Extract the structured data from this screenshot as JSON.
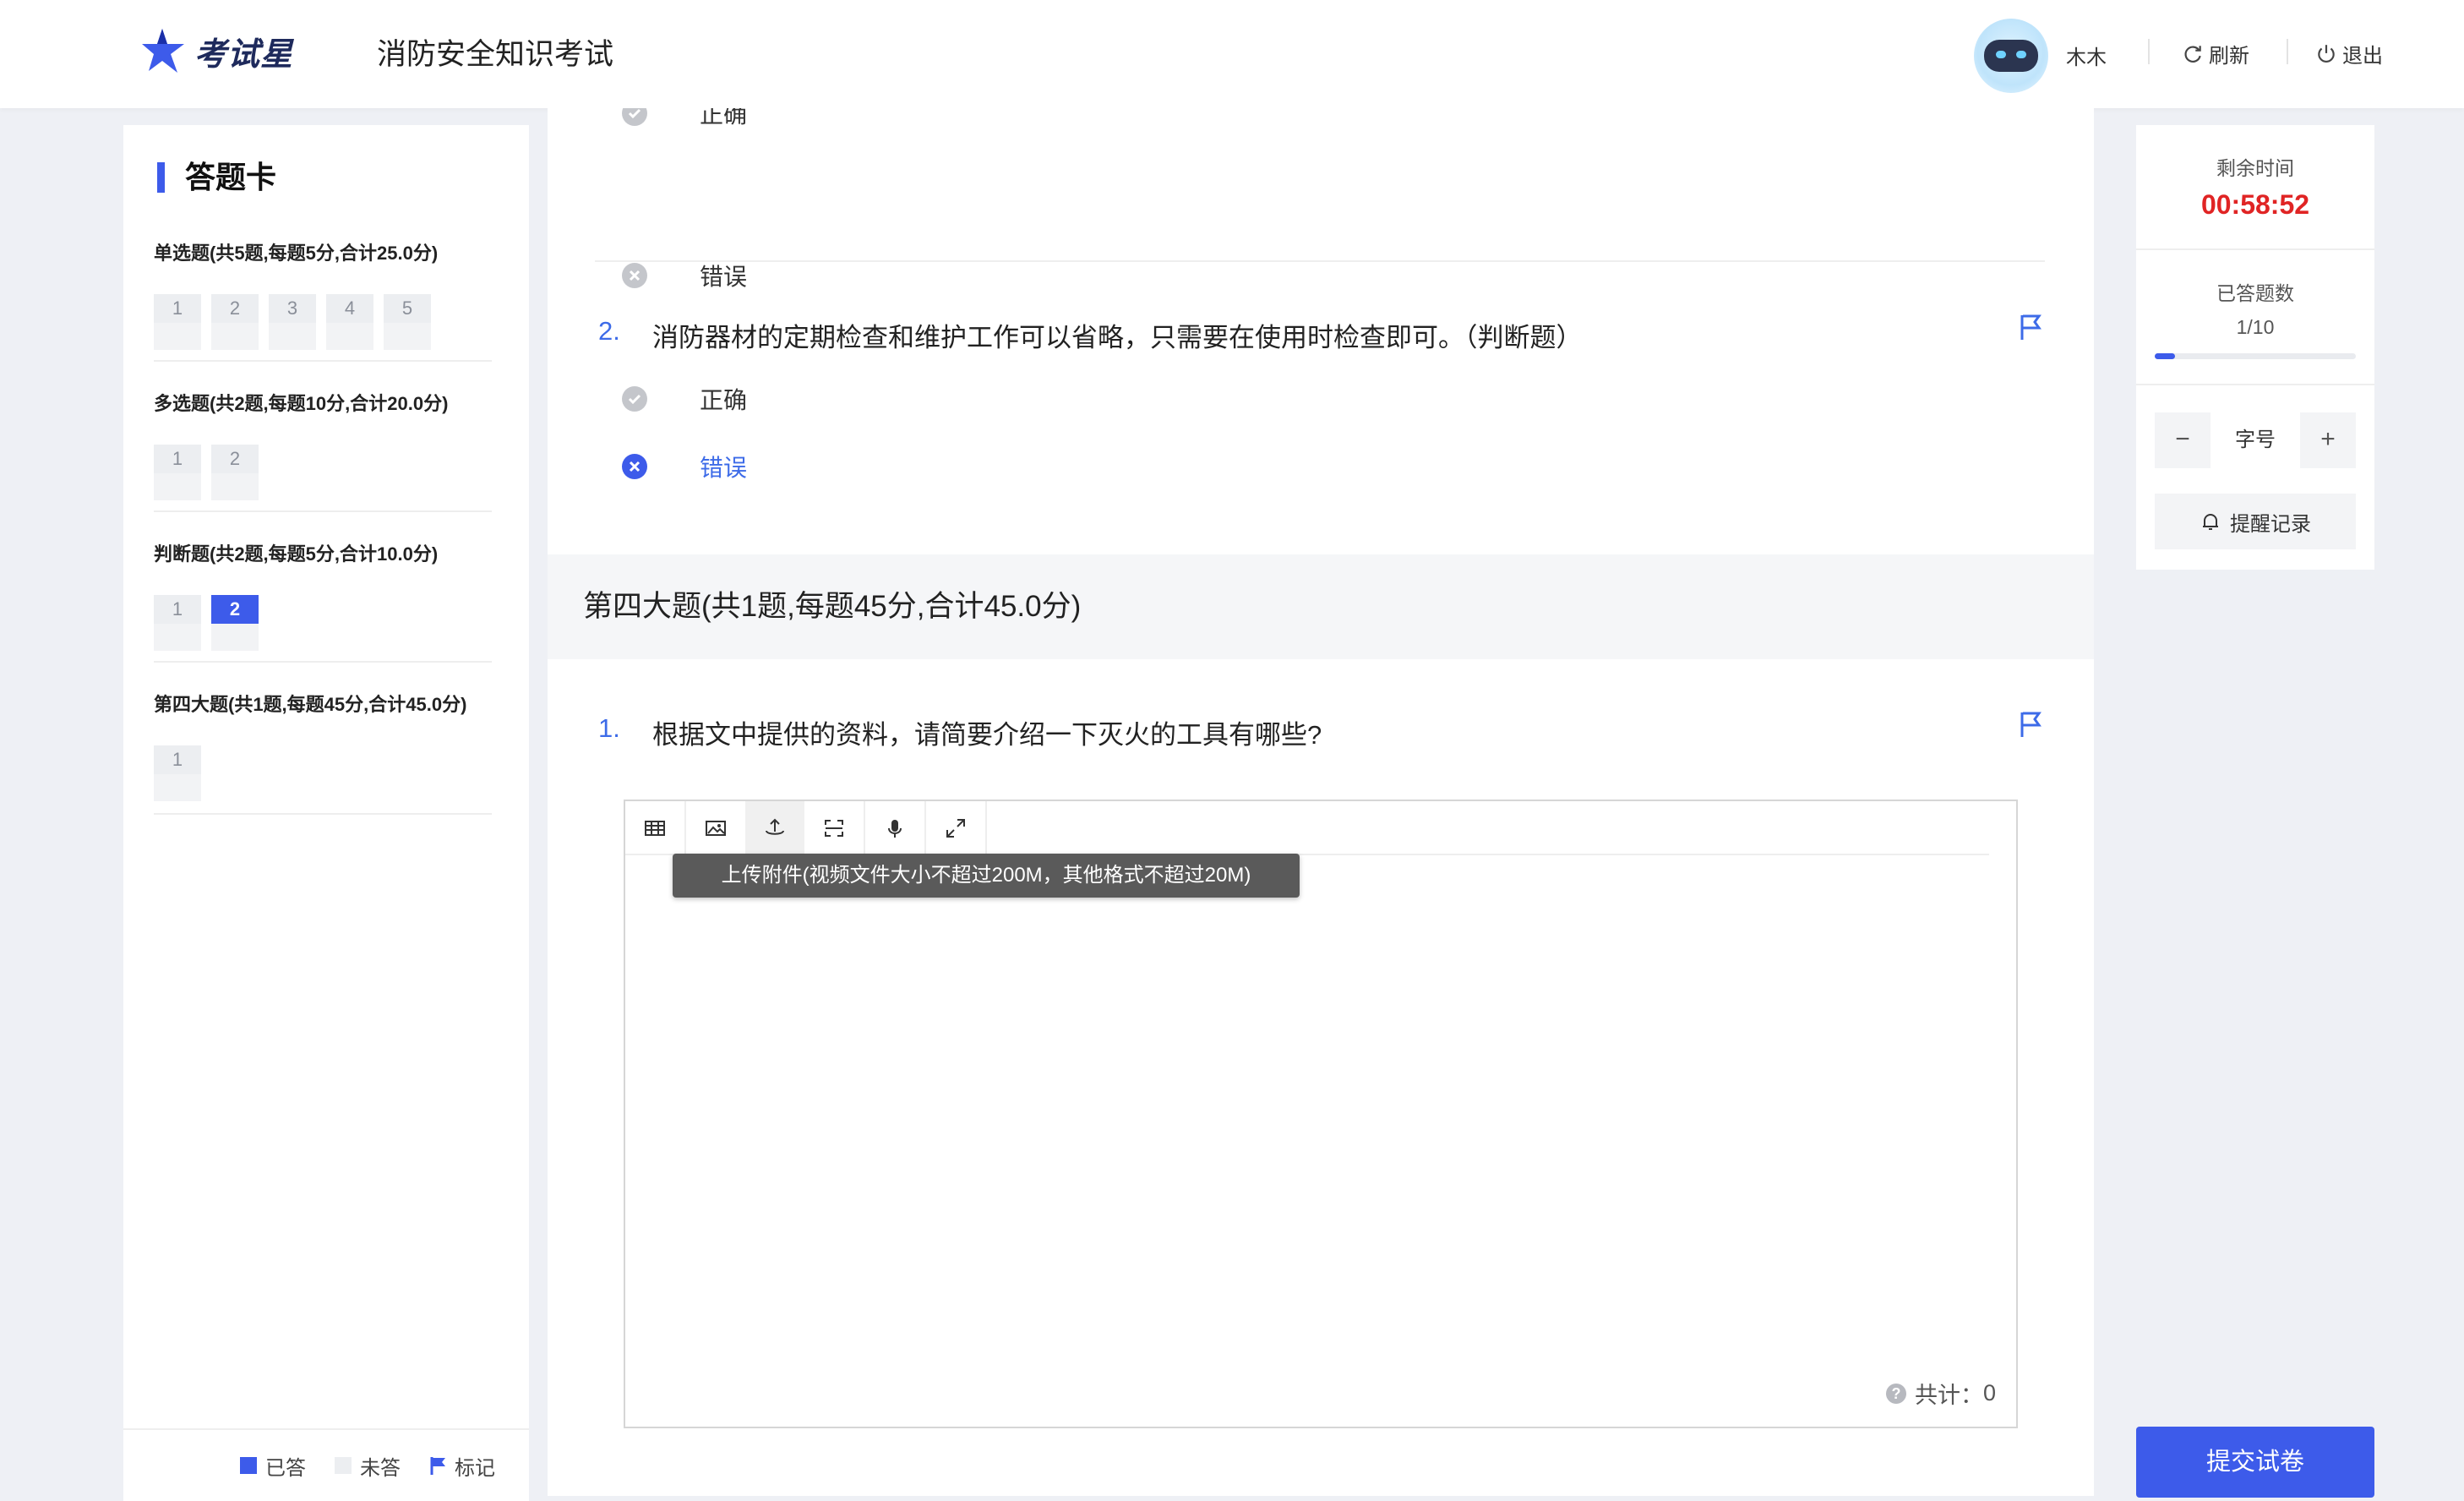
{
  "header": {
    "logo_text": "考试星",
    "exam_title": "消防安全知识考试",
    "username": "木木",
    "refresh_label": "刷新",
    "logout_label": "退出"
  },
  "answer_card": {
    "title": "答题卡",
    "sections": [
      {
        "title": "单选题(共5题,每题5分,合计25.0分)",
        "questions": [
          {
            "label": "1",
            "answered": false
          },
          {
            "label": "2",
            "answered": false
          },
          {
            "label": "3",
            "answered": false
          },
          {
            "label": "4",
            "answered": false
          },
          {
            "label": "5",
            "answered": false
          }
        ]
      },
      {
        "title": "多选题(共2题,每题10分,合计20.0分)",
        "questions": [
          {
            "label": "1",
            "answered": false
          },
          {
            "label": "2",
            "answered": false
          }
        ]
      },
      {
        "title": "判断题(共2题,每题5分,合计10.0分)",
        "questions": [
          {
            "label": "1",
            "answered": false
          },
          {
            "label": "2",
            "answered": true
          }
        ]
      },
      {
        "title": "第四大题(共1题,每题45分,合计45.0分)",
        "questions": [
          {
            "label": "1",
            "answered": false
          }
        ]
      }
    ],
    "legend": {
      "answered": "已答",
      "unanswered": "未答",
      "flagged": "标记"
    }
  },
  "main": {
    "prev_options": [
      {
        "label": "正确",
        "icon": "check-circle-icon",
        "selected": false
      },
      {
        "label": "错误",
        "icon": "x-circle-icon",
        "selected": false
      }
    ],
    "question2": {
      "number": "2.",
      "text": "消防器材的定期检查和维护工作可以省略，只需要在使用时检查即可。（判断题）",
      "options": [
        {
          "label": "正确",
          "icon": "check-circle-icon",
          "selected": false
        },
        {
          "label": "错误",
          "icon": "x-circle-icon",
          "selected": true
        }
      ]
    },
    "section4_title": "第四大题(共1题,每题45分,合计45.0分)",
    "question4_1": {
      "number": "1.",
      "text": "根据文中提供的资料，请简要介绍一下灭火的工具有哪些?"
    },
    "editor": {
      "toolbar": [
        "table-icon",
        "image-icon",
        "upload-icon",
        "screenshot-icon",
        "microphone-icon",
        "fullscreen-icon"
      ],
      "tooltip": "上传附件(视频文件大小不超过200M，其他格式不超过20M)",
      "counter_label": "共计：",
      "counter_value": "0"
    }
  },
  "sidebar": {
    "remaining_label": "剩余时间",
    "timer": "00:58:52",
    "answered_label": "已答题数",
    "answered_count": "1/10",
    "answered_fraction": 0.1,
    "font_label": "字号",
    "font_minus": "−",
    "font_plus": "+",
    "remind_label": "提醒记录",
    "submit_label": "提交试卷"
  },
  "colors": {
    "accent": "#3d5bea",
    "timer": "#e02424",
    "link": "#3d6be8"
  }
}
